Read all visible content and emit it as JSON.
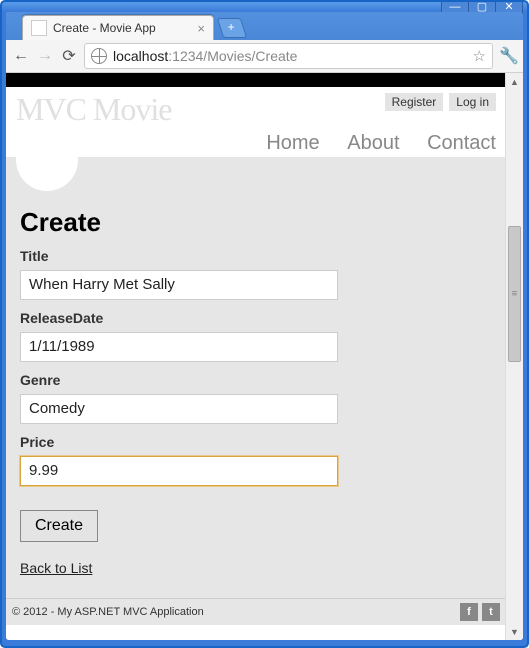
{
  "window": {
    "tab_title": "Create - Movie App",
    "url_host": "localhost",
    "url_port_path": ":1234/Movies/Create"
  },
  "header": {
    "brand": "MVC Movie",
    "auth": {
      "register": "Register",
      "login": "Log in"
    },
    "nav": {
      "home": "Home",
      "about": "About",
      "contact": "Contact"
    }
  },
  "form": {
    "heading": "Create",
    "fields": {
      "title": {
        "label": "Title",
        "value": "When Harry Met Sally"
      },
      "releaseDate": {
        "label": "ReleaseDate",
        "value": "1/11/1989"
      },
      "genre": {
        "label": "Genre",
        "value": "Comedy"
      },
      "price": {
        "label": "Price",
        "value": "9.99"
      }
    },
    "submit_label": "Create",
    "back_label": "Back to List"
  },
  "footer": {
    "text": "© 2012 - My ASP.NET MVC Application"
  }
}
